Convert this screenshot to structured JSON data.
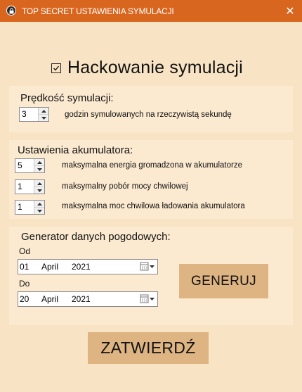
{
  "window": {
    "title": "TOP SECRET USTAWIENIA SYMULACJI",
    "close_glyph": "✕",
    "icon": "lock-icon"
  },
  "hacking": {
    "label": "Hackowanie symulacji",
    "checked": true
  },
  "speed": {
    "title": "Prędkość symulacji:",
    "value": "3",
    "description": "godzin symulowanych na rzeczywistą sekundę"
  },
  "battery": {
    "title": "Ustawienia akumulatora:",
    "rows": [
      {
        "value": "5",
        "description": "maksymalna energia gromadzona w akumulatorze"
      },
      {
        "value": "1",
        "description": "maksymalny pobór mocy chwilowej"
      },
      {
        "value": "1",
        "description": "maksymalna moc chwilowa ładowania akumulatora"
      }
    ]
  },
  "weather": {
    "title": "Generator danych pogodowych:",
    "from": {
      "label": "Od",
      "day": "01",
      "month": "April",
      "year": "2021"
    },
    "to": {
      "label": "Do",
      "day": "20",
      "month": "April",
      "year": "2021"
    },
    "generate_label": "GENERUJ"
  },
  "confirm_label": "ZATWIERDŹ",
  "colors": {
    "titlebar": "#d9661f",
    "background": "#f8e4c4",
    "panel": "#fbe9d0",
    "button": "#deb483"
  }
}
